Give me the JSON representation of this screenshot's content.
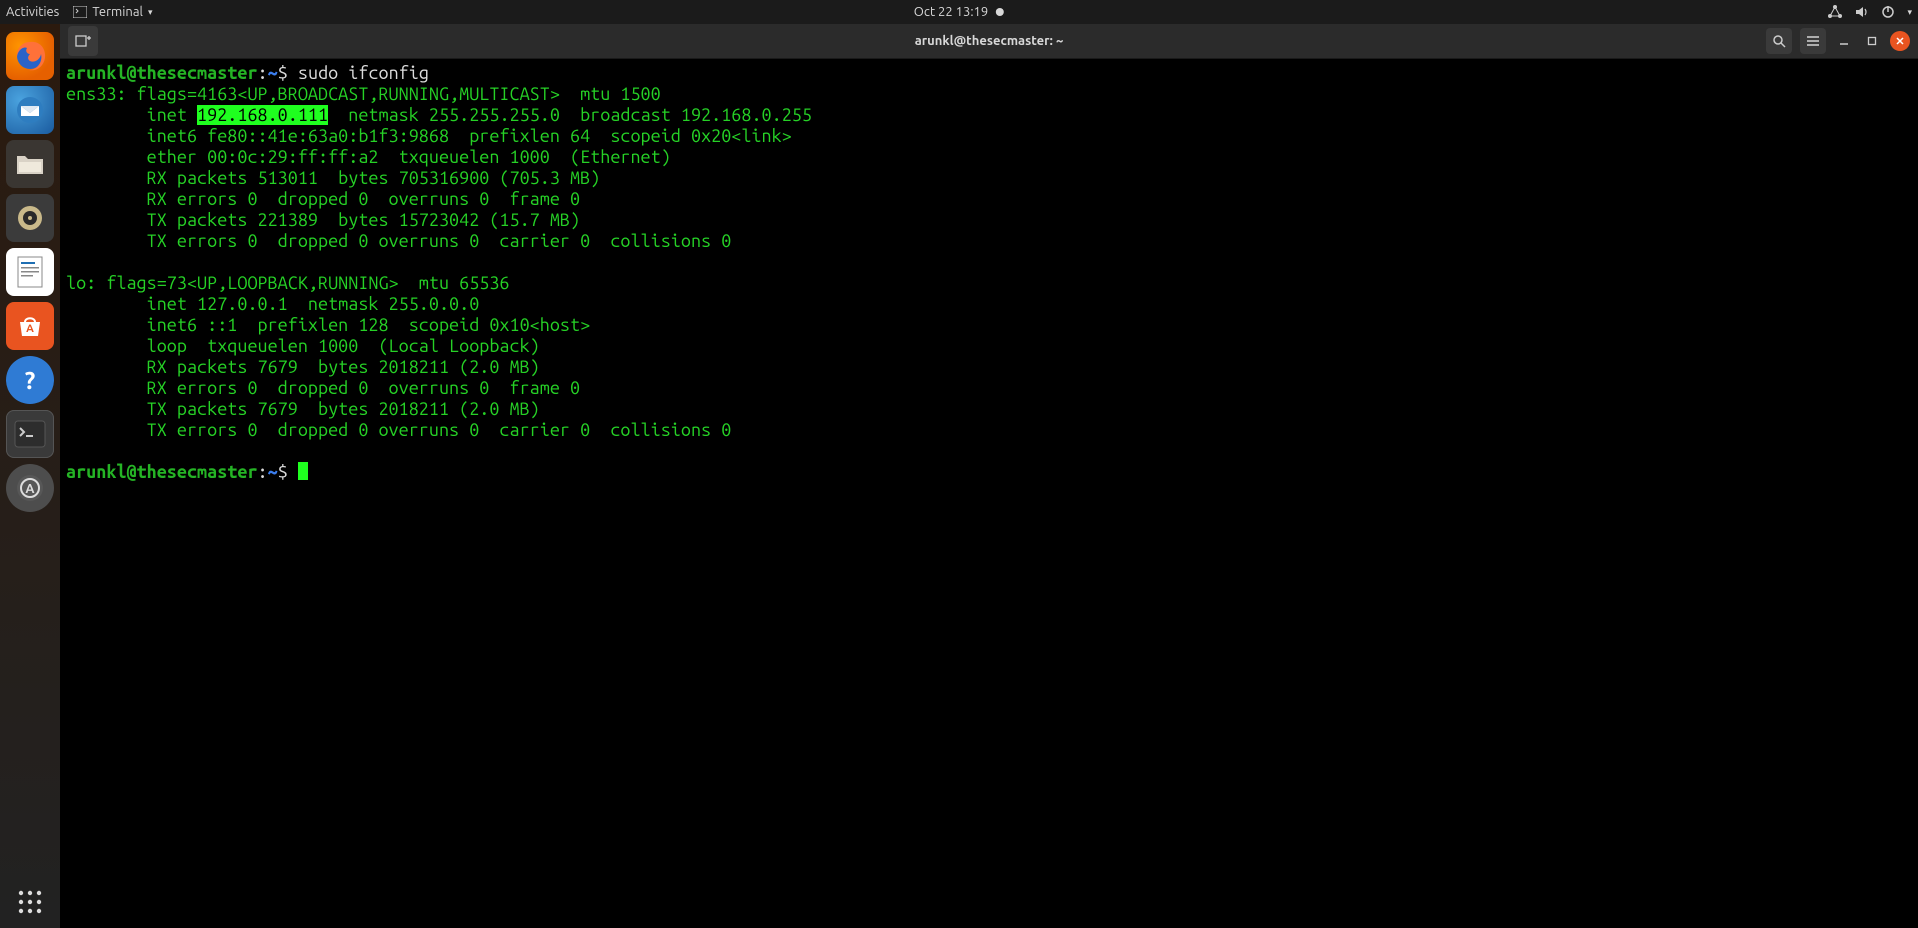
{
  "topbar": {
    "activities": "Activities",
    "app_label": "Terminal",
    "datetime": "Oct 22  13:19"
  },
  "dock": {
    "items": [
      {
        "name": "firefox",
        "glyph": "🦊"
      },
      {
        "name": "thunderbird",
        "glyph": "✉️"
      },
      {
        "name": "files",
        "glyph": "📁"
      },
      {
        "name": "rhythmbox",
        "glyph": "🔉"
      },
      {
        "name": "writer",
        "glyph": "📄"
      },
      {
        "name": "software",
        "glyph": "🛍️"
      },
      {
        "name": "help",
        "glyph": "?"
      },
      {
        "name": "terminal",
        "glyph": ">_"
      },
      {
        "name": "updater",
        "glyph": "A"
      }
    ]
  },
  "window": {
    "title": "arunkl@thesecmaster: ~"
  },
  "prompt": {
    "userhost": "arunkl@thesecmaster",
    "sep": ":",
    "path": "~",
    "sigil": "$"
  },
  "cmd1": "sudo ifconfig",
  "out": {
    "l1a": "ens33: flags=4163<UP,BROADCAST,RUNNING,MULTICAST>  mtu 1500",
    "l2a": "        inet ",
    "l2h": "192.168.0.111",
    "l2b": "  netmask 255.255.255.0  broadcast 192.168.0.255",
    "l3": "        inet6 fe80::41e:63a0:b1f3:9868  prefixlen 64  scopeid 0x20<link>",
    "l4": "        ether 00:0c:29:ff:ff:a2  txqueuelen 1000  (Ethernet)",
    "l5": "        RX packets 513011  bytes 705316900 (705.3 MB)",
    "l6": "        RX errors 0  dropped 0  overruns 0  frame 0",
    "l7": "        TX packets 221389  bytes 15723042 (15.7 MB)",
    "l8": "        TX errors 0  dropped 0 overruns 0  carrier 0  collisions 0",
    "b1": "lo: flags=73<UP,LOOPBACK,RUNNING>  mtu 65536",
    "b2": "        inet 127.0.0.1  netmask 255.0.0.0",
    "b3": "        inet6 ::1  prefixlen 128  scopeid 0x10<host>",
    "b4": "        loop  txqueuelen 1000  (Local Loopback)",
    "b5": "        RX packets 7679  bytes 2018211 (2.0 MB)",
    "b6": "        RX errors 0  dropped 0  overruns 0  frame 0",
    "b7": "        TX packets 7679  bytes 2018211 (2.0 MB)",
    "b8": "        TX errors 0  dropped 0 overruns 0  carrier 0  collisions 0"
  }
}
